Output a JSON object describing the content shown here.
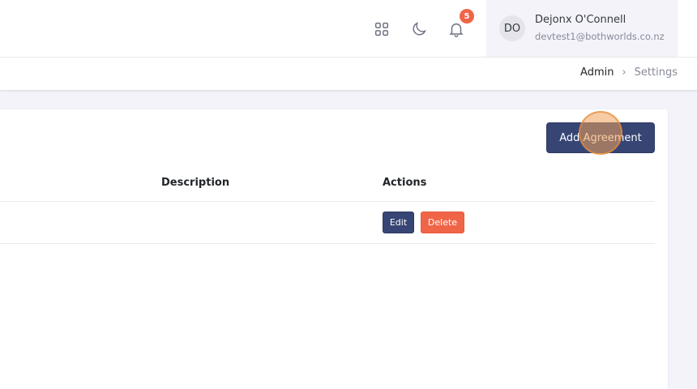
{
  "header": {
    "apps_icon": "grid-icon",
    "theme_icon": "moon-icon",
    "notifications_icon": "bell-icon",
    "notification_count": "5",
    "user": {
      "initials": "DO",
      "name": "Dejonx O'Connell",
      "email": "devtest1@bothworlds.co.nz"
    }
  },
  "breadcrumb": {
    "items": [
      "Admin",
      "Settings"
    ]
  },
  "main": {
    "add_button_label": "Add Agreement",
    "table": {
      "columns": [
        "Description",
        "Actions"
      ],
      "rows": [
        {
          "description": "",
          "edit_label": "Edit",
          "delete_label": "Delete"
        }
      ]
    }
  },
  "colors": {
    "primary": "#364574",
    "danger": "#f06548",
    "page_bg": "#f3f3f9"
  }
}
